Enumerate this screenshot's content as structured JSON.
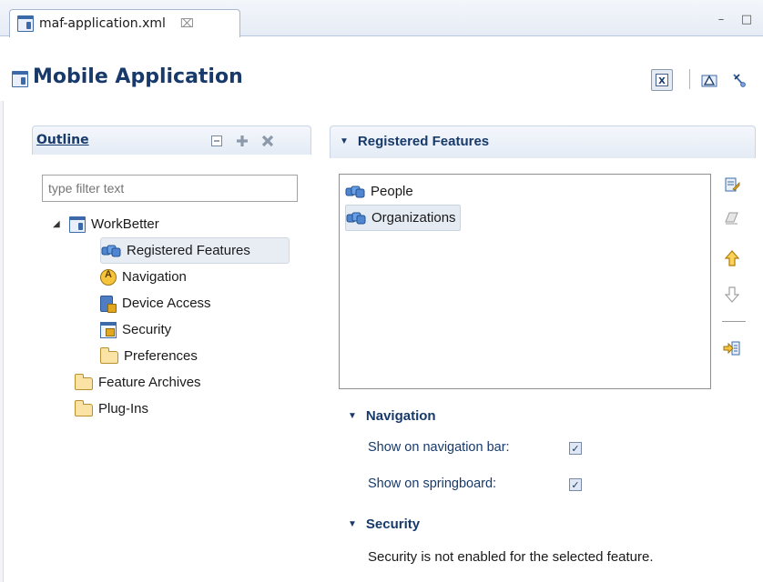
{
  "editor_tab": {
    "label": "maf-application.xml",
    "close_glyph": "⌧"
  },
  "window_controls": {
    "minimize": "–",
    "maximize": "□"
  },
  "editor": {
    "title": "Mobile Application"
  },
  "header_buttons": [
    {
      "icon": "source-xml-icon",
      "selected": true
    },
    {
      "icon": "overview-icon",
      "selected": false
    },
    {
      "icon": "pin-icon",
      "selected": false
    }
  ],
  "outline": {
    "title": "Outline",
    "filter_placeholder": "type filter text",
    "tree": [
      {
        "label": "WorkBetter",
        "icon": "application-icon",
        "expanded": true,
        "level": 0
      },
      {
        "label": "Registered Features",
        "icon": "feature-icon",
        "selected": true,
        "level": 1
      },
      {
        "label": "Navigation",
        "icon": "navigation-icon",
        "level": 1
      },
      {
        "label": "Device Access",
        "icon": "device-access-icon",
        "level": 1
      },
      {
        "label": "Security",
        "icon": "security-icon",
        "level": 1
      },
      {
        "label": "Preferences",
        "icon": "folder-icon",
        "level": 1
      },
      {
        "label": "Feature Archives",
        "icon": "folder-icon",
        "level": 0
      },
      {
        "label": "Plug-Ins",
        "icon": "folder-icon",
        "level": 0
      }
    ]
  },
  "registered_features": {
    "title": "Registered Features",
    "items": [
      {
        "label": "People",
        "selected": false
      },
      {
        "label": "Organizations",
        "selected": true
      }
    ]
  },
  "navigation_section": {
    "title": "Navigation",
    "show_on_navigation_bar": {
      "label": "Show on navigation bar:",
      "checked": true
    },
    "show_on_springboard": {
      "label": "Show on springboard:",
      "checked": true
    }
  },
  "security_section": {
    "title": "Security",
    "message": "Security is not enabled for the selected feature."
  },
  "colors": {
    "heading": "#173a6b",
    "selection": "#e5ebf3",
    "border": "#c9d5e6"
  }
}
